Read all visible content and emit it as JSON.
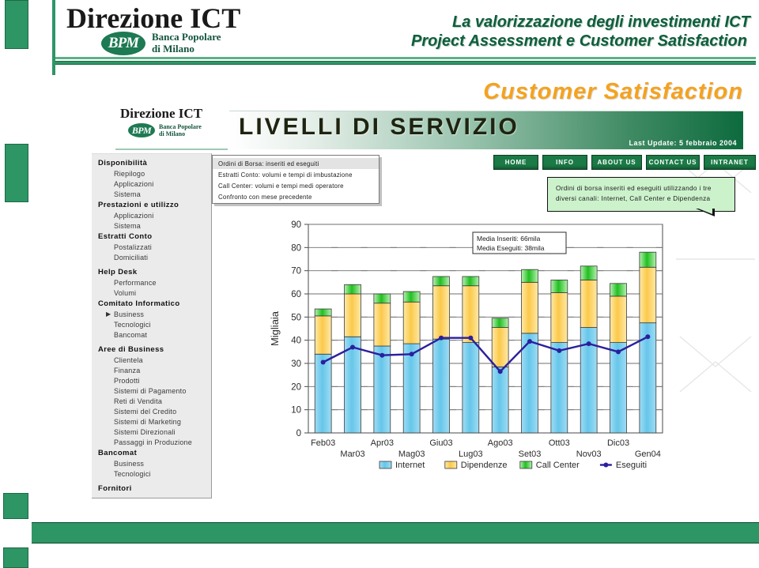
{
  "banner": {
    "brand_title": "Direzione ICT",
    "bpm_mark": "BPM",
    "bpm_line1": "Banca Popolare",
    "bpm_line2": "di Milano",
    "art_line1": "La valorizzazione degli investimenti ICT",
    "art_line2": "Project  Assessment e Customer Satisfaction"
  },
  "content_logo": {
    "title": "Direzione ICT",
    "bpm_mark": "BPM",
    "bpm_line1": "Banca Popolare",
    "bpm_line2": "di Milano"
  },
  "header": {
    "eyebrow": "Customer Satisfaction",
    "page_title": "LIVELLI DI SERVIZIO",
    "last_update": "Last Update: 5 febbraio 2004"
  },
  "topnav": [
    {
      "label": "HOME"
    },
    {
      "label": "INFO"
    },
    {
      "label": "ABOUT US"
    },
    {
      "label": "CONTACT US"
    },
    {
      "label": "INTRANET"
    }
  ],
  "sidebar": [
    {
      "type": "group",
      "label": "Disponibilità"
    },
    {
      "type": "item",
      "label": "Riepilogo"
    },
    {
      "type": "item",
      "label": "Applicazioni"
    },
    {
      "type": "item",
      "label": "Sistema"
    },
    {
      "type": "group",
      "label": "Prestazioni e utilizzo"
    },
    {
      "type": "item",
      "label": "Applicazioni"
    },
    {
      "type": "item",
      "label": "Sistema"
    },
    {
      "type": "group",
      "label": "Estratti Conto"
    },
    {
      "type": "item",
      "label": "Postalizzati"
    },
    {
      "type": "item",
      "label": "Domiciliati"
    },
    {
      "type": "spacer"
    },
    {
      "type": "group",
      "label": "Help Desk"
    },
    {
      "type": "item",
      "label": "Performance"
    },
    {
      "type": "item",
      "label": "Volumi"
    },
    {
      "type": "group",
      "label": "Comitato Informatico"
    },
    {
      "type": "item",
      "label": "Business",
      "arrow": "▶"
    },
    {
      "type": "item",
      "label": "Tecnologici"
    },
    {
      "type": "item",
      "label": "Bancomat"
    },
    {
      "type": "spacer"
    },
    {
      "type": "group",
      "label": "Aree di Business"
    },
    {
      "type": "item",
      "label": "Clientela"
    },
    {
      "type": "item",
      "label": "Finanza"
    },
    {
      "type": "item",
      "label": "Prodotti"
    },
    {
      "type": "item",
      "label": "Sistemi di Pagamento"
    },
    {
      "type": "item",
      "label": "Reti di Vendita"
    },
    {
      "type": "item",
      "label": "Sistemi del Credito"
    },
    {
      "type": "item",
      "label": "Sistemi di Marketing"
    },
    {
      "type": "item",
      "label": "Sistemi Direzionali"
    },
    {
      "type": "item",
      "label": "Passaggi in Produzione"
    },
    {
      "type": "group",
      "label": "Bancomat"
    },
    {
      "type": "item",
      "label": "Business"
    },
    {
      "type": "item",
      "label": "Tecnologici"
    },
    {
      "type": "spacer"
    },
    {
      "type": "group",
      "label": "Fornitori"
    }
  ],
  "infobox": [
    {
      "label": "Ordini di Borsa: inseriti ed eseguiti",
      "selected": true
    },
    {
      "label": "Estratti Conto: volumi e tempi di imbustazione",
      "selected": false
    },
    {
      "label": "Call Center: volumi e tempi medi operatore",
      "selected": false
    },
    {
      "label": "Confronto con mese precedente",
      "selected": false
    }
  ],
  "callout": {
    "text": "Ordini di borsa inseriti ed eseguiti utilizzando i tre diversi canali: Internet, Call Center e Dipendenza"
  },
  "colors": {
    "green_brand": "#2e9565",
    "green_dark": "#0d6b3e",
    "orange_title": "#f5a21e",
    "callout_bg": "#ccf2cc",
    "series_internet": "#86d3f0",
    "series_dipendenze": "#ffd966",
    "series_callcenter": "#3cc63c",
    "series_eseguiti": "#2b1f9e"
  },
  "chart_data": {
    "type": "bar",
    "subtype": "stacked-bar-with-line",
    "title": "",
    "xlabel": "",
    "ylabel": "Migliaia",
    "ylim": [
      0,
      90
    ],
    "ytick_step": 10,
    "yticks": [
      0,
      10,
      20,
      30,
      40,
      50,
      60,
      70,
      80,
      90
    ],
    "grid": true,
    "legend_position": "bottom",
    "categories": [
      "Feb03",
      "Mar03",
      "Apr03",
      "Mag03",
      "Giu03",
      "Lug03",
      "Ago03",
      "Set03",
      "Ott03",
      "Nov03",
      "Dic03",
      "Gen04"
    ],
    "series": [
      {
        "name": "Internet",
        "type": "bar",
        "color": "#86d3f0",
        "values": [
          34.0,
          41.5,
          37.5,
          38.5,
          40.5,
          39.0,
          28.5,
          43.0,
          39.0,
          45.5,
          39.0,
          47.5
        ]
      },
      {
        "name": "Dipendenze",
        "type": "bar",
        "color": "#ffd966",
        "values": [
          16.5,
          18.5,
          18.5,
          18.0,
          23.0,
          24.5,
          17.0,
          22.0,
          21.5,
          20.5,
          20.0,
          24.0
        ]
      },
      {
        "name": "Call Center",
        "type": "bar",
        "color": "#3cc63c",
        "values": [
          3.0,
          4.0,
          4.0,
          4.5,
          4.0,
          4.0,
          4.0,
          5.5,
          5.5,
          6.0,
          5.5,
          6.5
        ]
      },
      {
        "name": "Eseguiti",
        "type": "line",
        "color": "#2b1f9e",
        "values": [
          30.5,
          37.0,
          33.5,
          34.0,
          41.0,
          41.0,
          26.5,
          39.5,
          35.5,
          38.5,
          35.0,
          41.5
        ]
      }
    ],
    "annotation": {
      "lines": [
        "Media Inseriti: 66mila",
        "Media Eseguiti: 38mila"
      ]
    }
  }
}
